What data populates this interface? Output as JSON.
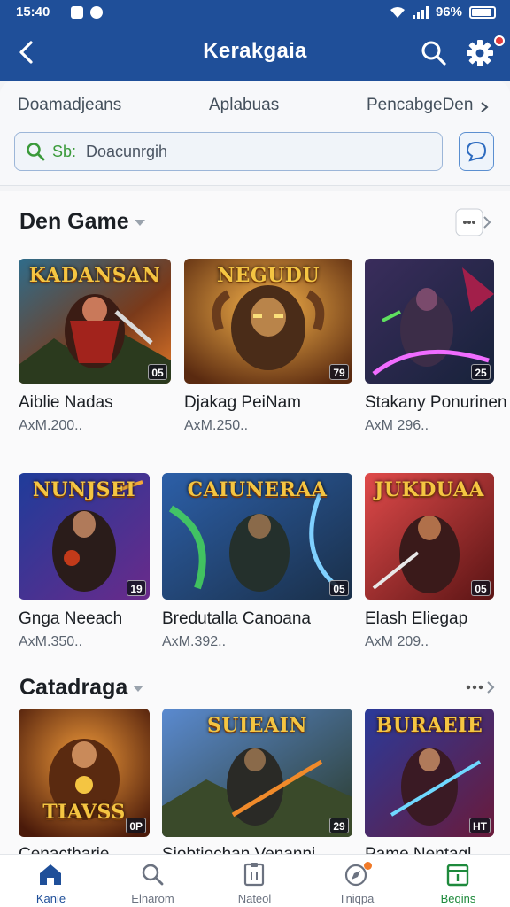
{
  "status_bar": {
    "time": "15:40",
    "battery": "96%"
  },
  "app_bar": {
    "title": "Kerakgaia",
    "back_icon": "chevron-left-icon",
    "search_icon": "search-icon",
    "settings_icon": "gear-icon"
  },
  "filters": {
    "tabs": [
      "Doamadjeans",
      "Aplabuas",
      "PencabgeDen"
    ],
    "search_prefix": "Sb:",
    "search_placeholder": "Doacunrgih"
  },
  "sections": [
    {
      "title": "Den Game",
      "games": [
        {
          "banner": "KADANSAN",
          "badge": "05",
          "name": "Aiblie Nadas",
          "meta": "AxM.200.."
        },
        {
          "banner": "NEGUDU",
          "badge": "79",
          "name": "Djakag PeiNam",
          "meta": "AxM.250.."
        },
        {
          "banner": "",
          "badge": "25",
          "name": "Stakany Ponurinen",
          "meta": "AxM 296.."
        },
        {
          "banner": "NUNJSEI",
          "badge": "19",
          "name": "Gnga Neeach",
          "meta": "AxM.350.."
        },
        {
          "banner": "CAIUNERAA",
          "badge": "05",
          "name": "Bredutalla Canoana",
          "meta": "AxM.392.."
        },
        {
          "banner": "JUKDUAA",
          "badge": "05",
          "name": "Elash Eliegap",
          "meta": "AxM 209.."
        }
      ]
    },
    {
      "title": "Catadraga",
      "games": [
        {
          "banner": "TIAVSS",
          "badge": "0P",
          "name": "Cenactharie",
          "meta": ""
        },
        {
          "banner": "SUIEAIN",
          "badge": "29",
          "name": "Siobtiochan Venanni",
          "meta": ""
        },
        {
          "banner": "BURAEIE",
          "badge": "HT",
          "name": "Pame Nentagl",
          "meta": ""
        }
      ]
    }
  ],
  "bottom_nav": [
    {
      "label": "Kanie",
      "icon": "home-icon"
    },
    {
      "label": "Elnarom",
      "icon": "search-icon"
    },
    {
      "label": "Nateol",
      "icon": "clipboard-icon"
    },
    {
      "label": "Tniqpa",
      "icon": "compass-icon"
    },
    {
      "label": "Beqins",
      "icon": "calendar-icon"
    }
  ],
  "colors": {
    "primary": "#1f4f99",
    "green_accent": "#1e8a3c",
    "notification": "#e23b3b"
  }
}
